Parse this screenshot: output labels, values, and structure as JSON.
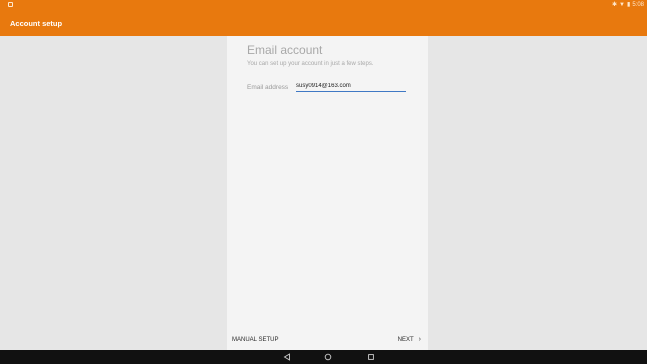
{
  "status_bar": {
    "left_icon": "notification-icon",
    "right_icons": [
      "bluetooth-icon",
      "wifi-icon",
      "battery-icon"
    ],
    "time": "5:08"
  },
  "action_bar": {
    "title": "Account setup",
    "color": "#e8790e"
  },
  "card": {
    "title": "Email account",
    "subtitle": "You can set up your account in just a few steps.",
    "email_label": "Email address",
    "email_value": "susy0914@163.com"
  },
  "footer": {
    "manual_setup_label": "MANUAL SETUP",
    "next_label": "NEXT"
  },
  "nav_bar": {
    "icons": [
      "back-icon",
      "home-icon",
      "recent-apps-icon"
    ]
  },
  "colors": {
    "accent": "#e8790e",
    "input_underline": "#3f78c4",
    "background": "#e6e6e6",
    "card": "#f4f4f4"
  }
}
